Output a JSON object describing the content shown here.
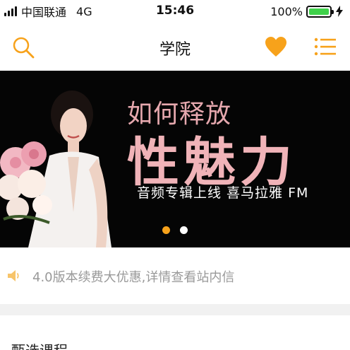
{
  "status_bar": {
    "carrier": "中国联通",
    "network": "4G",
    "time": "15:46",
    "battery_percent": "100%",
    "battery_color": "#3fd14a"
  },
  "nav": {
    "title": "学院",
    "accent_color": "#f7a21b",
    "icons": [
      "search-icon",
      "heart-icon",
      "list-menu-icon"
    ]
  },
  "banner": {
    "line1": "如何释放",
    "line2": "性魅力",
    "line3": "音频专辑上线 喜马拉雅 FM",
    "pages": 2,
    "active_page": 1
  },
  "notice": {
    "text": "4.0版本续费大优惠,详情查看站内信",
    "icon": "speaker-icon"
  },
  "section": {
    "title": "甄选课程"
  }
}
